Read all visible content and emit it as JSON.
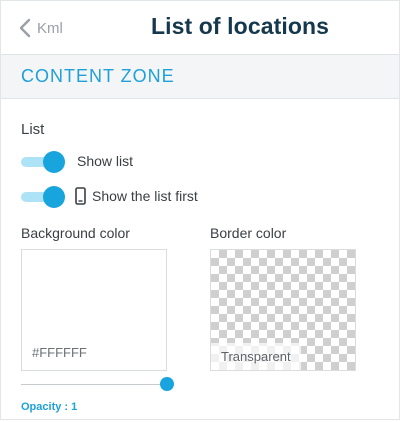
{
  "header": {
    "back_label": "Kml",
    "title": "List of locations"
  },
  "section": {
    "title": "CONTENT ZONE"
  },
  "list": {
    "label": "List",
    "toggles": [
      {
        "label": "Show list",
        "on": true
      },
      {
        "label": "Show the list first",
        "on": true,
        "icon": "mobile-phone-icon"
      }
    ]
  },
  "colors": {
    "background": {
      "label": "Background color",
      "value": "#FFFFFF"
    },
    "border": {
      "label": "Border color",
      "value": "Transparent"
    }
  },
  "opacity": {
    "label": "Opacity : 1",
    "value": 1
  },
  "theme": {
    "accent": "#18a5de",
    "title_color": "#16384d"
  }
}
